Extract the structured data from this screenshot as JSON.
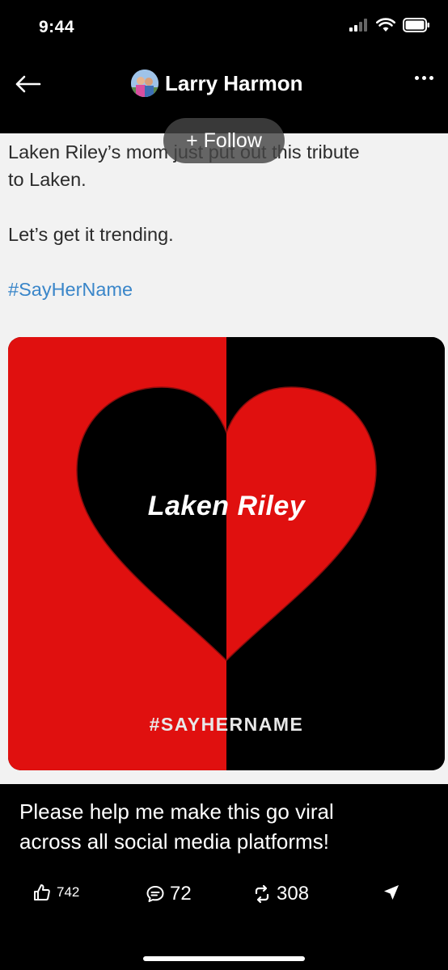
{
  "status_bar": {
    "time": "9:44"
  },
  "header": {
    "author_name": "Larry Harmon"
  },
  "follow_button": {
    "label": "+ Follow"
  },
  "post": {
    "text_line1": "Laken Riley’s mom just put out this tribute",
    "text_line2": "to Laken.",
    "text_line3": "Let’s get it trending.",
    "hashtag": "#SayHerName"
  },
  "image": {
    "title_part1": "Laken",
    "title_part2": "Riley",
    "tag": "#SAYHERNAME",
    "colors": {
      "red": "#e0100f",
      "black": "#000000"
    }
  },
  "caption": {
    "line1": "Please help me make this go viral",
    "line2": "across all social media platforms!"
  },
  "actions": {
    "likes": "742",
    "comments": "72",
    "reposts": "308"
  }
}
